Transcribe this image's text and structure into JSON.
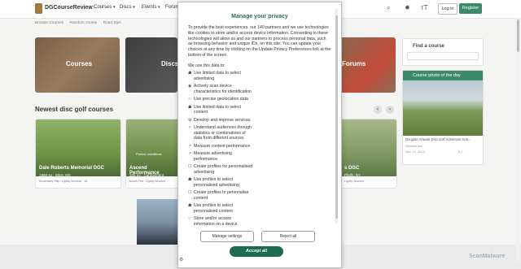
{
  "header": {
    "brand": "DGCourseReview",
    "nav": [
      "Courses",
      "Discs",
      "Events",
      "Forums"
    ],
    "login": "Log in",
    "register": "Register"
  },
  "breadcrumb": [
    "Browse Courses",
    "Random course",
    "Road trips"
  ],
  "tiles": [
    {
      "label": "Courses"
    },
    {
      "label": "Discs"
    },
    {
      "label": "Forums"
    }
  ],
  "sidebar": {
    "find_course": "Find a course",
    "photo_title": "Course photo of the day",
    "photo_caption": "Douglas Artwork Disc Golf Adventure in B...",
    "photo_user": "Slimestrobe",
    "photo_date": "Dec 12, 2024",
    "photo_likes": "5",
    "photo_comments": "2"
  },
  "newest": {
    "title": "Newest disc golf courses",
    "cards": [
      {
        "name": "Dale Roberts Memorial DGC",
        "holes": "18",
        "area": "1869 sq",
        "location": "Mtns, MS",
        "tags": [
          "Moderately Hilly",
          "Lightly Wooded"
        ],
        "rating": "18"
      },
      {
        "name": "Ascend Performance",
        "holes": "9",
        "area": "335 mi",
        "location": "Cantonment",
        "tags": [
          "Mostly Flat",
          "Lightly Wooded"
        ],
        "status": "Perfect conditions"
      },
      {
        "name": "s DGC",
        "location": "Pfeifs, NY",
        "tags": [
          "Lightly Wooded"
        ]
      }
    ]
  },
  "privacy": {
    "title": "Manage your privacy",
    "intro": "To provide the best experiences, our 140 partners and we use technologies like cookies to store and/or access device information. Consenting to these technologies will allow us and our partners to process personal data, such as browsing behavior and unique IDs, on this site. You can update your choices at any time by clicking on the Update Privacy Preferences link at the bottom of the screen.",
    "lead": "We use this data to:",
    "purposes": [
      {
        "icon": "☗",
        "text": "Use limited data to select advertising"
      },
      {
        "icon": "◉",
        "text": "Actively scan device characteristics for identification"
      },
      {
        "icon": "○",
        "text": "Use precise geolocation data"
      },
      {
        "icon": "☗",
        "text": "Use limited data to select content"
      },
      {
        "icon": "⚙",
        "text": "Develop and improve services"
      },
      {
        "icon": "✧",
        "text": "Understand audiences through statistics or combinations of data from different sources"
      },
      {
        "icon": "↗",
        "text": "Measure content performance"
      },
      {
        "icon": "↗",
        "text": "Measure advertising performance"
      },
      {
        "icon": "☐",
        "text": "Create profiles for personalised advertising"
      },
      {
        "icon": "☗",
        "text": "Use profiles to select personalised advertising"
      },
      {
        "icon": "☐",
        "text": "Create profiles to personalise content"
      },
      {
        "icon": "☗",
        "text": "Use profiles to select personalised content"
      },
      {
        "icon": "○",
        "text": "Store and/or access information on a device"
      }
    ],
    "manage": "Manage settings",
    "reject": "Reject all",
    "accept": "Accept all"
  },
  "watermark": "ScanMalware",
  "colors": {
    "brand": "#3c8a6b",
    "accept": "#1d6b52"
  }
}
